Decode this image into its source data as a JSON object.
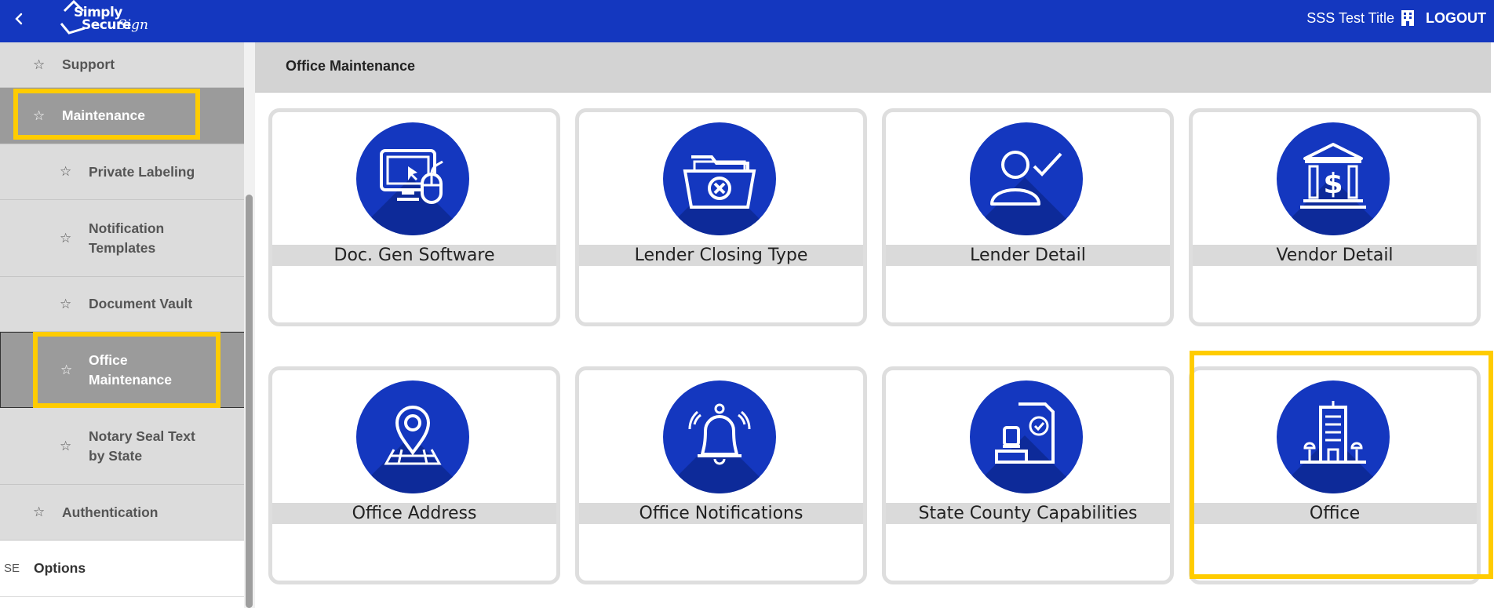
{
  "header": {
    "logo_line1": "Simply",
    "logo_line2": "Secure",
    "logo_sign": "Sign",
    "company_name": "SSS Test Title",
    "logout_label": "LOGOUT",
    "bar_color": "#1437bf"
  },
  "sidebar": {
    "items": [
      {
        "label": "Support",
        "level": 1,
        "state": "normal"
      },
      {
        "label": "Maintenance",
        "level": 1,
        "state": "expanded"
      },
      {
        "label": "Private Labeling",
        "level": 2,
        "state": "normal"
      },
      {
        "label": "Notification Templates",
        "level": 2,
        "state": "normal"
      },
      {
        "label": "Document Vault",
        "level": 2,
        "state": "normal"
      },
      {
        "label": "Office Maintenance",
        "level": 2,
        "state": "selected"
      },
      {
        "label": "Notary Seal Text by State",
        "level": 2,
        "state": "normal"
      },
      {
        "label": "Authentication",
        "level": 1,
        "state": "normal"
      },
      {
        "label": "Options",
        "level": 0,
        "state": "normal",
        "prefix": "SE"
      }
    ]
  },
  "main": {
    "page_title": "Office Maintenance",
    "tiles": [
      {
        "label": "Doc. Gen Software",
        "icon": "computer-mouse-icon"
      },
      {
        "label": "Lender Closing Type",
        "icon": "folder-x-icon"
      },
      {
        "label": "Lender Detail",
        "icon": "user-check-icon"
      },
      {
        "label": "Vendor Detail",
        "icon": "bank-dollar-icon"
      },
      {
        "label": "Office Address",
        "icon": "map-pin-icon"
      },
      {
        "label": "Office Notifications",
        "icon": "bell-icon"
      },
      {
        "label": "State County Capabilities",
        "icon": "stamp-document-icon"
      },
      {
        "label": "Office",
        "icon": "office-building-icon"
      }
    ]
  },
  "colors": {
    "accent": "#1437bf",
    "highlight": "#ffcc00",
    "sidebar_bg": "#dcdcdc",
    "sidebar_active": "#9b9b9b"
  }
}
